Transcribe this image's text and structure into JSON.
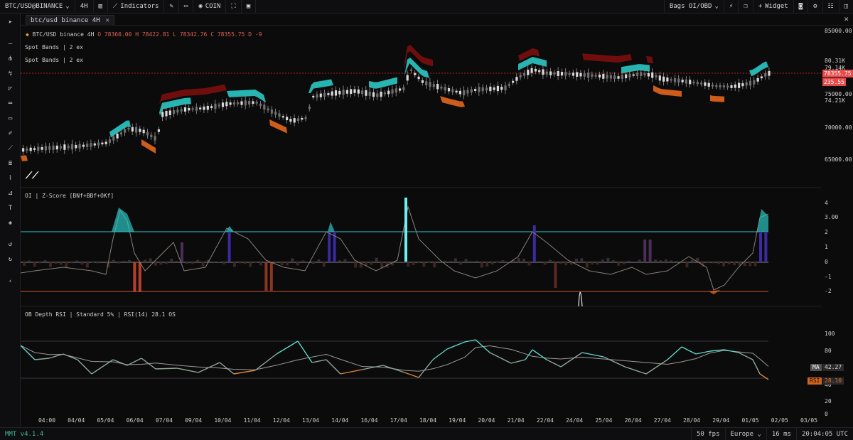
{
  "topbar": {
    "symbol": "BTC/USD@BINANCE",
    "interval": "4H",
    "indicators_label": "Indicators",
    "coin_label": "COIN",
    "layout_label": "Bags OI/OBD",
    "widget_label": "Widget"
  },
  "tab": {
    "label": "btc/usd binance 4H"
  },
  "legend": {
    "main_title": "BTC/USD binance 4H",
    "ohlc": {
      "o": "O 78360.00",
      "h": "H 78422.81",
      "l": "L 78342.76",
      "c": "C 78355.75",
      "d": "D -9"
    },
    "overlay1": "Spot Bands | 2 ex",
    "overlay2": "Spot Bands | 2 ex",
    "oi_title": "OI | Z-Score [BNf+BBf+OKf]",
    "rsi_title": "OB Depth RSI | Standard 5% | RSI(14) 28.1 OS"
  },
  "price_axis": [
    "85000.00",
    "80.31K",
    "79.14K",
    "75000.00",
    "74.21K",
    "70000.00",
    "65000.00"
  ],
  "price_tags": {
    "last": "78355.75",
    "countdown": "235.55"
  },
  "oi_axis": [
    "4",
    "3.00",
    "2",
    "1",
    "0",
    "-1",
    "-2"
  ],
  "rsi_axis": [
    "100",
    "80",
    "60",
    "40",
    "20",
    "0"
  ],
  "rsi_tags": {
    "ma_label": "MA",
    "ma_value": "42.27",
    "rsi_label": "RSI",
    "rsi_value": "28.10"
  },
  "x_axis": [
    "04:00",
    "04/04",
    "05/04",
    "06/04",
    "07/04",
    "09/04",
    "10/04",
    "11/04",
    "12/04",
    "13/04",
    "14/04",
    "16/04",
    "17/04",
    "18/04",
    "19/04",
    "20/04",
    "21/04",
    "22/04",
    "24/04",
    "25/04",
    "26/04",
    "27/04",
    "28/04",
    "29/04",
    "01/05",
    "02/05",
    "03/05"
  ],
  "statusbar": {
    "version": "MMT v4.1.4",
    "fps": "50 fps",
    "region": "Europe",
    "latency": "16 ms",
    "clock": "20:04:05 UTC"
  },
  "colors": {
    "bg": "#0b0b0c",
    "teal": "#2bc4c0",
    "red": "#7a0f0f",
    "orange": "#e0641c",
    "candle": "#bdbdbd",
    "accent": "#e84a4a"
  }
}
